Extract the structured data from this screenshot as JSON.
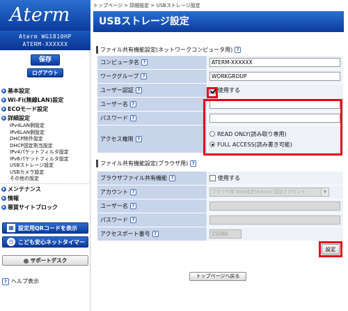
{
  "brand": {
    "logo": "Aterm",
    "model": "Aterm WG1810HP",
    "device": "ATERM-XXXXXX"
  },
  "sidebar": {
    "save_label": "保存",
    "logout_label": "ログアウト",
    "nav": [
      {
        "label": "基本設定"
      },
      {
        "label": "Wi-Fi(無線LAN)設定"
      },
      {
        "label": "ECOモード設定"
      },
      {
        "label": "詳細設定"
      }
    ],
    "sub_items": [
      "IPv4LAN側設定",
      "IPv6LAN側設定",
      "DHCP除外設定",
      "DHCP固定割当設定",
      "IPv4パケットフィルタ設定",
      "IPv6パケットフィルタ設定",
      "USBストレージ設定",
      "USBカメラ設定",
      "その他の設定"
    ],
    "nav2": [
      {
        "label": "メンテナンス"
      },
      {
        "label": "情報"
      },
      {
        "label": "悪質サイトブロック"
      }
    ],
    "qr_button": "設定用QRコードを表示",
    "timer_button": "こども安心ネットタイマー",
    "support_button": "サポートデスク",
    "help_link": "ヘルプ表示"
  },
  "header": {
    "breadcrumb": "トップページ > 詳細設定 > USBストレージ設定",
    "title": "USBストレージ設定"
  },
  "section1": {
    "title": "ファイル共有機能設定(ネットワークコンピュータ用)",
    "rows": {
      "computer_name_label": "コンピュータ名",
      "computer_name_value": "ATERM-XXXXXX",
      "workgroup_label": "ワークグループ",
      "workgroup_value": "WORKGROUP",
      "auth_label": "ユーザー認証",
      "auth_check_label": "使用する",
      "user_label": "ユーザー名",
      "user_value": "",
      "password_label": "パスワード",
      "password_value": "",
      "access_label": "アクセス権限",
      "access_ro": "READ ONLY(読み取り専用)",
      "access_full": "FULL ACCESS(読み書き可能)"
    }
  },
  "section2": {
    "title": "ファイル共有機能設定(ブラウザ用)",
    "rows": {
      "browser_share_label": "ブラウザファイル共有機能",
      "browser_share_check": "使用する",
      "account_label": "アカウント",
      "account_value": "ブラウザ用 Web設定(Admin) 認証アカウント",
      "user_label": "ユーザー名",
      "password_label": "パスワード",
      "port_label": "アクセスポート番号",
      "port_value": "15080"
    }
  },
  "actions": {
    "apply": "設定",
    "back_top": "トップページへ戻る"
  },
  "help_glyph": "?"
}
